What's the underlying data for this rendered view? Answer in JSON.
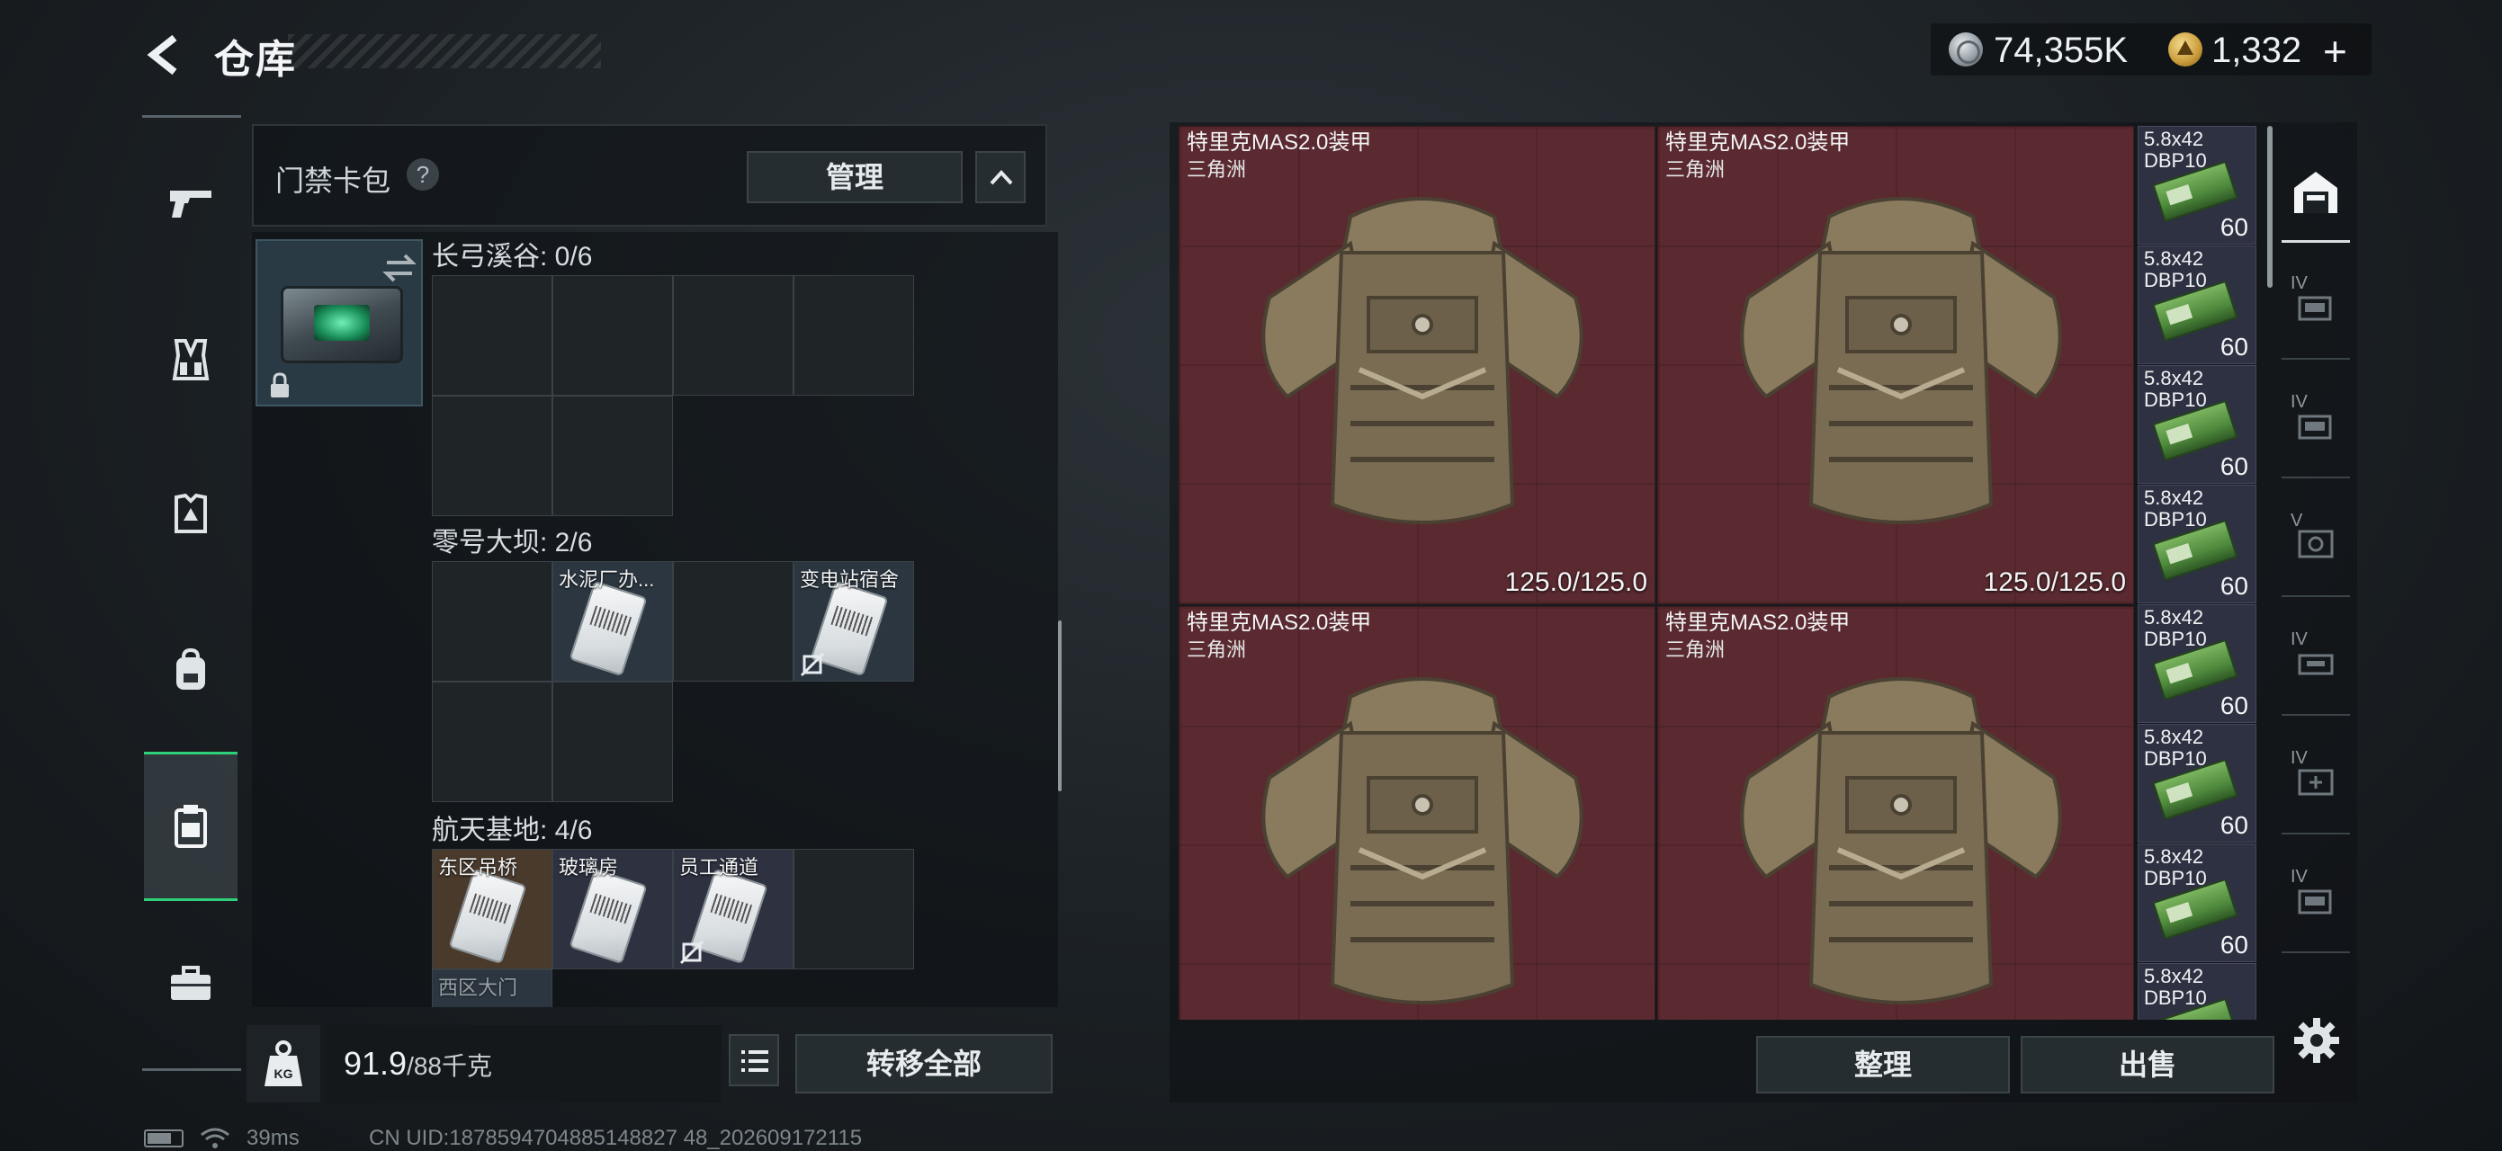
{
  "header": {
    "title": "仓库",
    "currency": {
      "silver_amount": "74,355K",
      "gold_amount": "1,332",
      "plus_symbol": "+"
    }
  },
  "left_rail": {
    "items": [
      {
        "icon": "pistol-icon"
      },
      {
        "icon": "vest-rig-icon"
      },
      {
        "icon": "armor-plate-icon"
      },
      {
        "icon": "backpack-icon"
      },
      {
        "icon": "keycard-case-icon",
        "active": true
      },
      {
        "icon": "toolbox-icon"
      }
    ]
  },
  "card_pack": {
    "title": "门禁卡包",
    "help": "?",
    "manage_label": "管理",
    "maps": [
      {
        "label": "长弓溪谷: 0/6",
        "cells": []
      },
      {
        "label": "零号大坝: 2/6",
        "cells": [
          "水泥厂办...",
          "变电站宿舍"
        ]
      },
      {
        "label": "航天基地: 4/6",
        "cells": [
          "东区吊桥",
          "玻璃房",
          "员工通道",
          "西区大门"
        ]
      }
    ]
  },
  "weight": {
    "current": "91.9",
    "limit": "/88千克",
    "icon_label": "KG"
  },
  "footer": {
    "transfer_all_label": "转移全部",
    "sort_label": "整理",
    "sell_label": "出售"
  },
  "armor_items": [
    {
      "name": "特里克MAS2.0装甲",
      "map": "三角洲",
      "durability": "125.0/125.0"
    },
    {
      "name": "特里克MAS2.0装甲",
      "map": "三角洲",
      "durability": "125.0/125.0"
    },
    {
      "name": "特里克MAS2.0装甲",
      "map": "三角洲",
      "durability": ""
    },
    {
      "name": "特里克MAS2.0装甲",
      "map": "三角洲",
      "durability": ""
    }
  ],
  "ammo_items": [
    {
      "name": "5.8x42 DBP10",
      "count": "60"
    },
    {
      "name": "5.8x42 DBP10",
      "count": "60"
    },
    {
      "name": "5.8x42 DBP10",
      "count": "60"
    },
    {
      "name": "5.8x42 DBP10",
      "count": "60"
    },
    {
      "name": "5.8x42 DBP10",
      "count": "60"
    },
    {
      "name": "5.8x42 DBP10",
      "count": "60"
    },
    {
      "name": "5.8x42 DBP10",
      "count": "60"
    },
    {
      "name": "5.8x42 DBP10",
      "count": ""
    }
  ],
  "warehouse_tabs": [
    {
      "label": "IV"
    },
    {
      "label": "IV"
    },
    {
      "label": "V"
    },
    {
      "label": "IV"
    },
    {
      "label": "IV"
    },
    {
      "label": "IV"
    }
  ],
  "status_bar": {
    "ping": "39ms",
    "uid": "CN UID:1878594704885148827 48_202609172115"
  },
  "colors": {
    "accent_green": "#2ed17a",
    "armor_bg": "#5a2a30",
    "ammo_bg": "#2e3142"
  }
}
